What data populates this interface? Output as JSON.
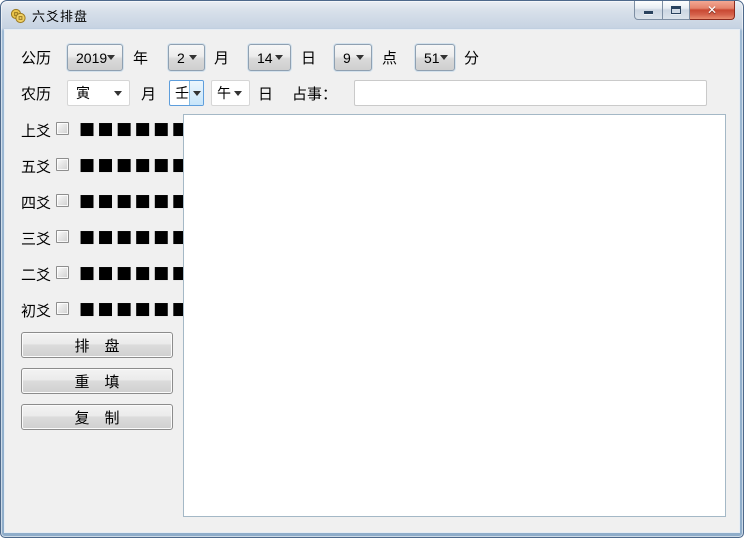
{
  "window": {
    "title": "六爻排盘",
    "icon": "coins-icon",
    "controls": {
      "minimize": "minimize",
      "maximize": "maximize",
      "close": "✕"
    }
  },
  "colors": {
    "client_bg": "#f0f0f0",
    "frame_blue": "#8fadca",
    "close_red": "#c94832",
    "focused_combo_border": "#5e9edc",
    "yao_square": "#000000"
  },
  "solar": {
    "label": "公历",
    "year_value": "2019",
    "year_unit": "年",
    "month_value": "2",
    "month_unit": "月",
    "day_value": "14",
    "day_unit": "日",
    "hour_value": "9",
    "hour_unit": "点",
    "minute_value": "51",
    "minute_unit": "分"
  },
  "lunar": {
    "label": "农历",
    "month_value": "寅",
    "month_unit": "月",
    "stem_value": "壬",
    "branch_value": "午",
    "branch_unit": "日",
    "matter_label": "占事：",
    "matter_value": ""
  },
  "yao": {
    "rows": [
      {
        "label": "上爻",
        "checked": false,
        "squares": "■■■■■■"
      },
      {
        "label": "五爻",
        "checked": false,
        "squares": "■■■■■■"
      },
      {
        "label": "四爻",
        "checked": false,
        "squares": "■■■■■■"
      },
      {
        "label": "三爻",
        "checked": false,
        "squares": "■■■■■■"
      },
      {
        "label": "二爻",
        "checked": false,
        "squares": "■■■■■■"
      },
      {
        "label": "初爻",
        "checked": false,
        "squares": "■■■■■■"
      }
    ]
  },
  "buttons": {
    "paipan": "排　盘",
    "chongtian": "重　填",
    "fuzhi": "复　制"
  },
  "output": {
    "value": ""
  }
}
